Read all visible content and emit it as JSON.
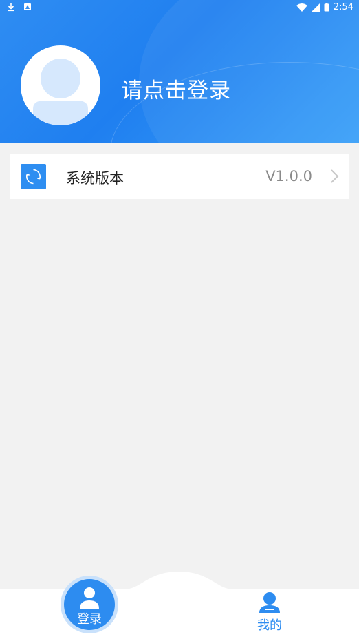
{
  "status_bar": {
    "time": "2:54"
  },
  "header": {
    "login_prompt": "请点击登录"
  },
  "settings_row": {
    "label": "系统版本",
    "value": "V1.0.0"
  },
  "tabbar": {
    "login_label": "登录",
    "mine_label": "我的"
  },
  "colors": {
    "accent": "#2d8cf0",
    "header_gradient_start": "#2f8df2",
    "background": "#f2f2f2"
  },
  "icons": {
    "status_left": [
      "download-icon",
      "notification-icon"
    ],
    "status_right": [
      "wifi-icon",
      "signal-icon",
      "battery-icon"
    ],
    "row": "refresh-icon",
    "tabs": [
      "person-icon",
      "person-icon"
    ]
  }
}
